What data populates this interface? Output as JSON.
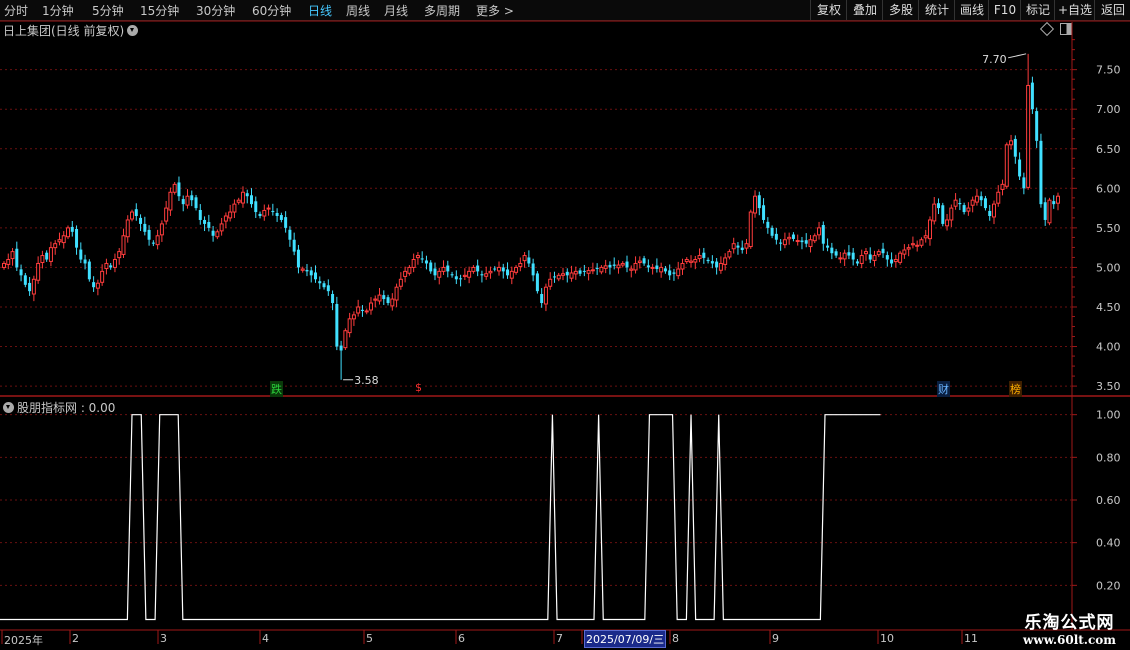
{
  "toolbar": {
    "periods": [
      "分时",
      "1分钟",
      "5分钟",
      "15分钟",
      "30分钟",
      "60分钟",
      "日线",
      "周线",
      "月线",
      "多周期",
      "更多"
    ],
    "active": "日线",
    "right_buttons": [
      "复权",
      "叠加",
      "多股",
      "统计",
      "画线",
      "F10",
      "标记",
      "+自选",
      "返回"
    ]
  },
  "main_panel": {
    "title": "日上集团(日线 前复权)",
    "high_label": "7.70",
    "low_label": "3.58",
    "markers": [
      {
        "text": "跌",
        "color": "#2bd23b",
        "bg": "#0a3a0a"
      },
      {
        "text": "$",
        "color": "#ff3030",
        "bg": "#000"
      },
      {
        "text": "财",
        "color": "#6ab4ff",
        "bg": "#0a1f40"
      },
      {
        "text": "榜",
        "color": "#ffb000",
        "bg": "#402000"
      }
    ]
  },
  "indicator_panel": {
    "title": "股朋指标网 : 0.00"
  },
  "x_axis": {
    "labels": [
      "2025年",
      "2",
      "3",
      "4",
      "5",
      "6",
      "7",
      "2025/07/09/三",
      "8",
      "9",
      "10",
      "11"
    ]
  },
  "brand": {
    "name": "乐淘公式网",
    "url": "www.60lt.com"
  },
  "colors": {
    "up": "#ff3d3d",
    "down": "#40e0ff",
    "grid": "#6a1010",
    "axis": "#a01818",
    "line": "#ffffff",
    "active_tab": "#45c8ff"
  },
  "chart_data": [
    {
      "type": "candlestick",
      "title": "日上集团(日线 前复权)",
      "ylim": [
        3.4,
        7.9
      ],
      "yticks": [
        3.5,
        4.0,
        4.5,
        5.0,
        5.5,
        6.0,
        6.5,
        7.0,
        7.5
      ],
      "annotations": [
        {
          "text": "7.70",
          "value": 7.7
        },
        {
          "text": "3.58",
          "value": 3.58
        }
      ],
      "month_ticks": [
        "2025年",
        "2",
        "3",
        "4",
        "5",
        "6",
        "7",
        "8",
        "9",
        "10",
        "11"
      ],
      "crosshair_date": "2025/07/09/三",
      "close": [
        5.05,
        5.1,
        5.2,
        5.0,
        4.9,
        4.78,
        4.7,
        4.85,
        5.05,
        5.15,
        5.1,
        5.25,
        5.3,
        5.35,
        5.4,
        5.5,
        5.45,
        5.25,
        5.1,
        5.05,
        4.85,
        4.75,
        4.8,
        4.95,
        5.05,
        5.0,
        5.1,
        5.2,
        5.4,
        5.6,
        5.7,
        5.65,
        5.55,
        5.45,
        5.35,
        5.3,
        5.4,
        5.55,
        5.75,
        5.95,
        6.05,
        5.9,
        5.8,
        5.9,
        5.85,
        5.75,
        5.6,
        5.55,
        5.5,
        5.4,
        5.45,
        5.55,
        5.65,
        5.7,
        5.8,
        5.85,
        5.95,
        5.9,
        5.8,
        5.7,
        5.65,
        5.72,
        5.75,
        5.7,
        5.65,
        5.6,
        5.5,
        5.35,
        5.2,
        5.0,
        4.98,
        4.95,
        4.9,
        4.85,
        4.8,
        4.75,
        4.7,
        4.55,
        4.0,
        3.95,
        4.2,
        4.35,
        4.4,
        4.5,
        4.45,
        4.45,
        4.55,
        4.6,
        4.65,
        4.6,
        4.55,
        4.6,
        4.75,
        4.85,
        4.95,
        5.0,
        5.1,
        5.15,
        5.1,
        5.05,
        4.95,
        4.9,
        4.95,
        5.0,
        4.95,
        4.9,
        4.85,
        4.85,
        4.9,
        4.95,
        5.0,
        4.95,
        4.9,
        4.92,
        4.95,
        4.98,
        5.0,
        4.95,
        4.9,
        4.95,
        5.0,
        5.05,
        5.15,
        5.05,
        4.9,
        4.7,
        4.55,
        4.75,
        4.85,
        4.88,
        4.9,
        4.92,
        4.9,
        4.93,
        4.95,
        4.92,
        4.95,
        4.96,
        4.97,
        4.98,
        5.0,
        5.02,
        5.0,
        5.02,
        5.03,
        5.05,
        5.0,
        4.98,
        5.05,
        5.08,
        5.05,
        5.0,
        5.0,
        4.98,
        5.0,
        4.95,
        4.9,
        4.92,
        4.98,
        5.05,
        5.1,
        5.08,
        5.1,
        5.15,
        5.12,
        5.08,
        5.05,
        5.0,
        5.05,
        5.12,
        5.2,
        5.3,
        5.25,
        5.22,
        5.3,
        5.7,
        5.9,
        5.75,
        5.6,
        5.5,
        5.4,
        5.35,
        5.3,
        5.35,
        5.38,
        5.36,
        5.34,
        5.32,
        5.3,
        5.35,
        5.4,
        5.5,
        5.3,
        5.25,
        5.18,
        5.15,
        5.12,
        5.18,
        5.15,
        5.1,
        5.05,
        5.15,
        5.2,
        5.1,
        5.15,
        5.2,
        5.18,
        5.1,
        5.05,
        5.1,
        5.18,
        5.22,
        5.25,
        5.3,
        5.28,
        5.35,
        5.4,
        5.6,
        5.8,
        5.75,
        5.55,
        5.6,
        5.75,
        5.85,
        5.8,
        5.7,
        5.75,
        5.85,
        5.9,
        5.85,
        5.75,
        5.65,
        5.8,
        5.95,
        6.05,
        6.55,
        6.6,
        6.4,
        6.15,
        6.0,
        5.8,
        5.6,
        5.85,
        5.8,
        5.9
      ],
      "jump": {
        "after_index": 239,
        "close": [
          7.3,
          7.0,
          6.6
        ]
      }
    },
    {
      "type": "line",
      "title": "股朋指标网",
      "value_label": "0.00",
      "ylim": [
        0,
        1.05
      ],
      "yticks": [
        0.2,
        0.4,
        0.6,
        0.8,
        1.0
      ],
      "high_segments": [
        [
          22,
          24
        ],
        [
          28,
          28
        ],
        [
          29,
          32
        ],
        [
          113,
          113
        ],
        [
          123,
          123
        ],
        [
          134,
          139
        ],
        [
          143,
          143
        ],
        [
          149,
          149
        ],
        [
          172,
          184
        ]
      ],
      "line_end_index": 184
    }
  ]
}
